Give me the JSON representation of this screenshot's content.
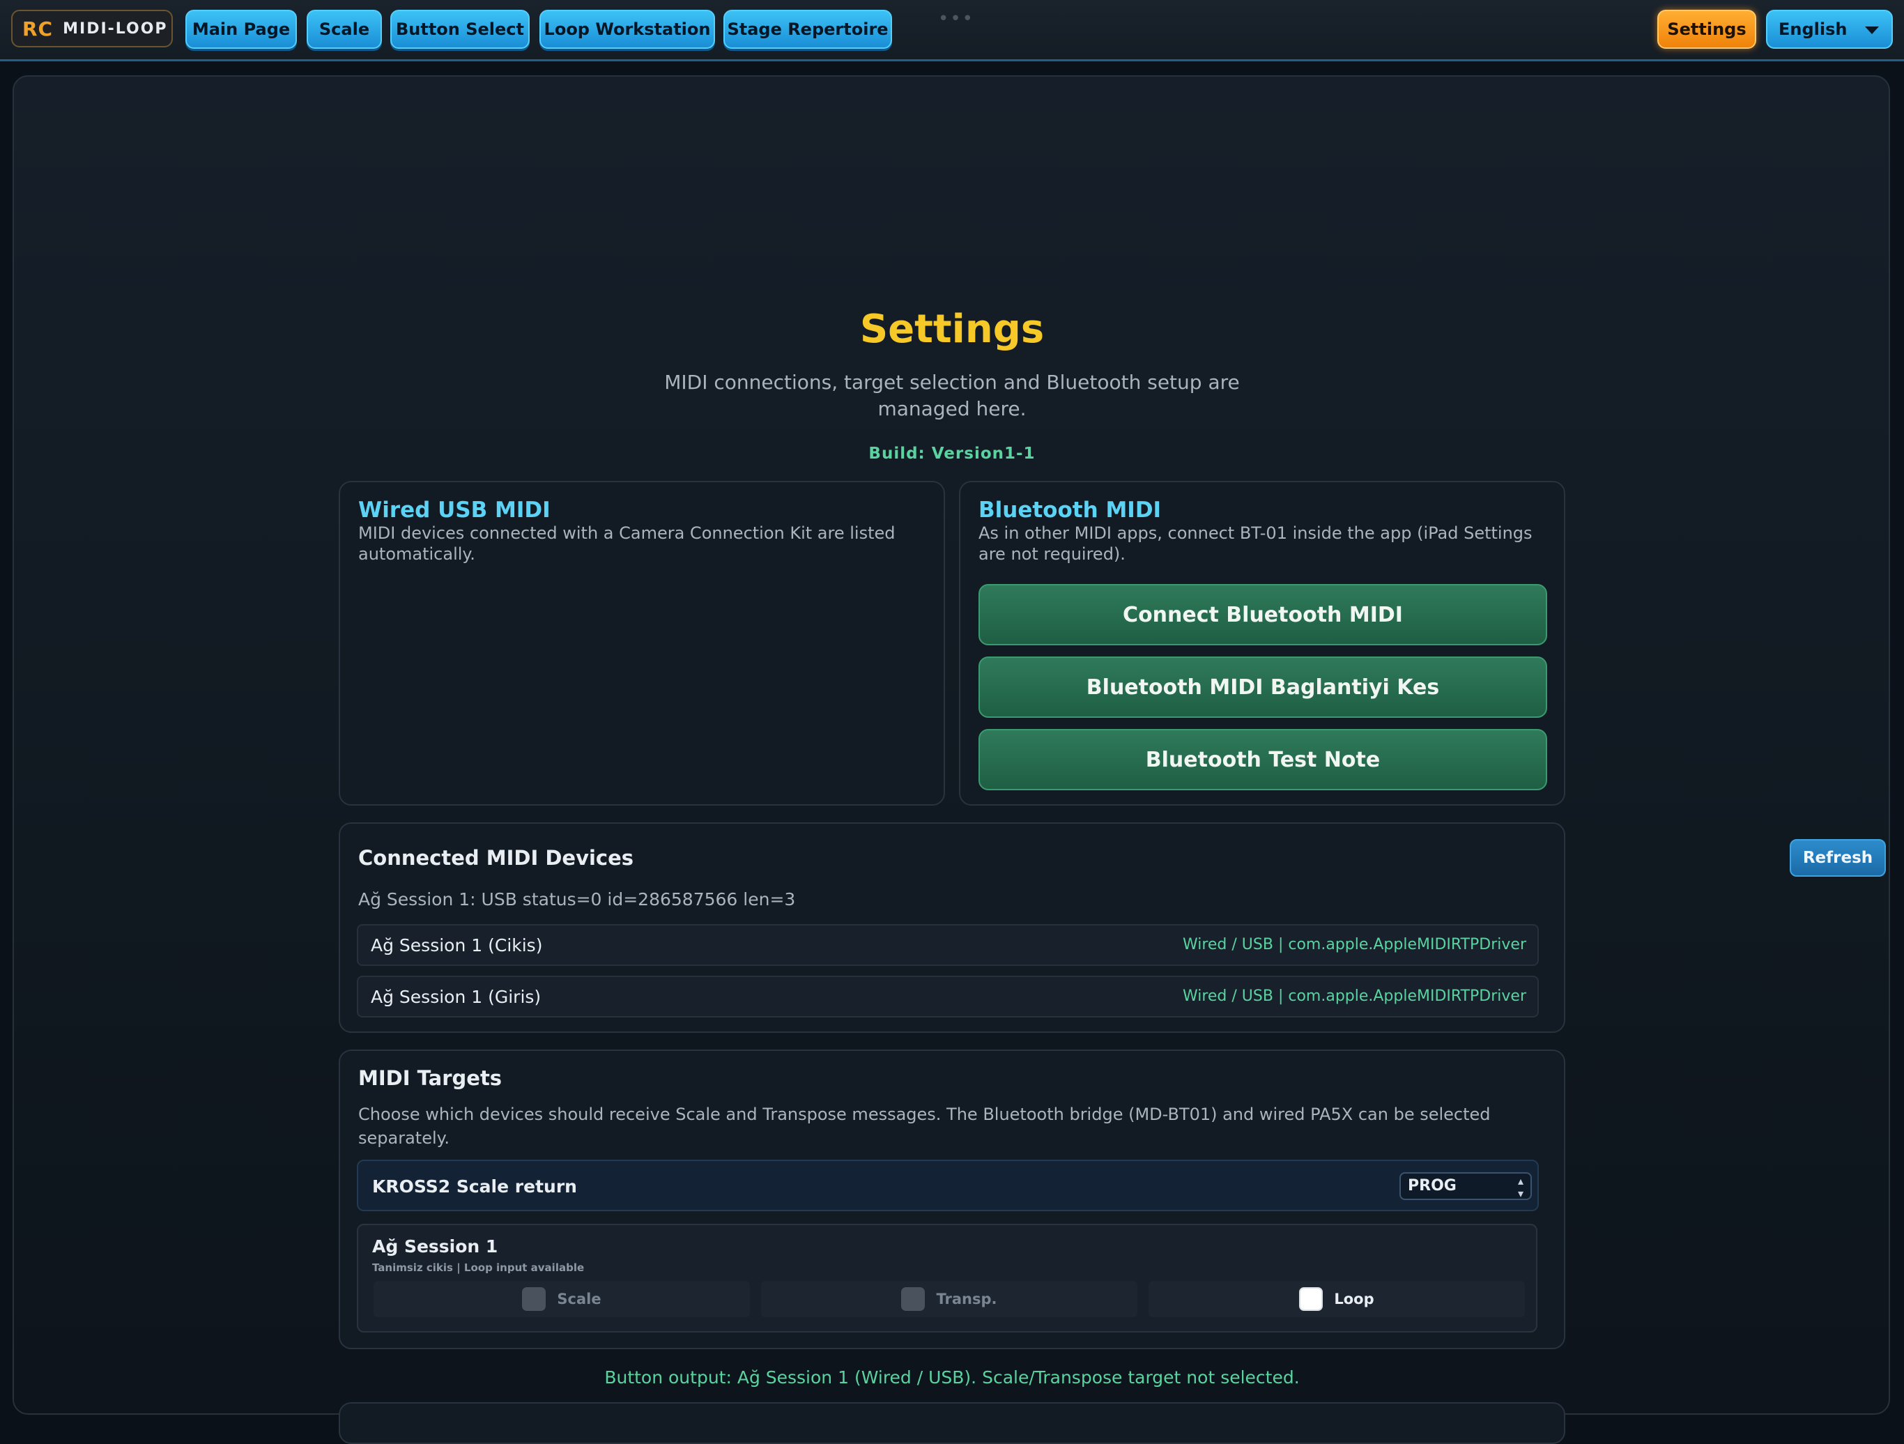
{
  "topbar": {
    "logo_mark": "RC",
    "logo_name": "MIDI-LOOP",
    "nav": [
      "Main Page",
      "Scale",
      "Button Select",
      "Loop Workstation",
      "Stage Repertoire"
    ],
    "settings_label": "Settings",
    "language": "English"
  },
  "header": {
    "title": "Settings",
    "subtitle": "MIDI connections, target selection and Bluetooth setup are managed here.",
    "build": "Build: Version1-1"
  },
  "wired": {
    "title": "Wired USB MIDI",
    "description": "MIDI devices connected with a Camera Connection Kit are listed automatically."
  },
  "bluetooth": {
    "title": "Bluetooth MIDI",
    "description": "As in other MIDI apps, connect BT-01 inside the app (iPad Settings are not required).",
    "buttons": [
      "Connect Bluetooth MIDI",
      "Bluetooth MIDI Baglantiyi Kes",
      "Bluetooth Test Note"
    ]
  },
  "devices": {
    "title": "Connected MIDI Devices",
    "refresh_label": "Refresh",
    "status": "Ağ Session 1: USB status=0 id=286587566 len=3",
    "rows": [
      {
        "name": "Ağ Session 1 (Cikis)",
        "meta": "Wired / USB | com.apple.AppleMIDIRTPDriver"
      },
      {
        "name": "Ağ Session 1 (Giris)",
        "meta": "Wired / USB | com.apple.AppleMIDIRTPDriver"
      }
    ]
  },
  "targets": {
    "title": "MIDI Targets",
    "description": "Choose which devices should receive Scale and Transpose messages. The Bluetooth bridge (MD-BT01) and wired PA5X can be selected separately.",
    "kross_label": "KROSS2 Scale return",
    "kross_value": "PROG",
    "session": {
      "name": "Ağ Session 1",
      "subtitle": "Tanimsiz cikis | Loop input available",
      "options": [
        {
          "label": "Scale",
          "enabled": false
        },
        {
          "label": "Transp.",
          "enabled": false
        },
        {
          "label": "Loop",
          "enabled": true,
          "checked": false
        }
      ]
    }
  },
  "footer_note": "Button output: Ağ Session 1 (Wired / USB). Scale/Transpose target not selected."
}
